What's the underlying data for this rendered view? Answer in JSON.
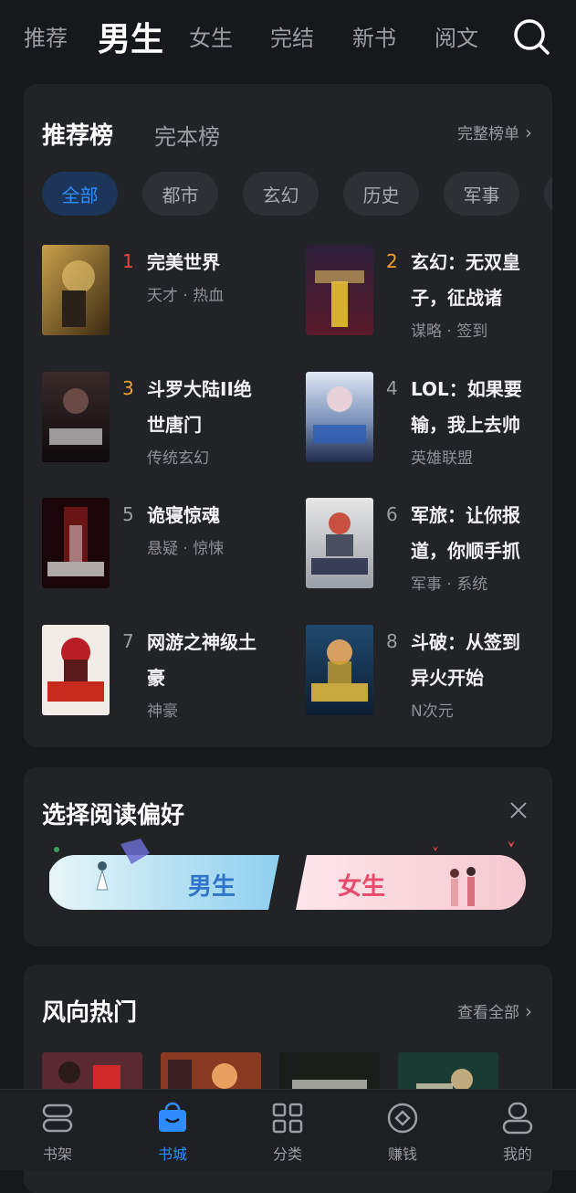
{
  "top_tabs": [
    "推荐",
    "男生",
    "女生",
    "完结",
    "新书",
    "阅文"
  ],
  "active_top_tab": "男生",
  "ranking": {
    "tabs": [
      "推荐榜",
      "完本榜"
    ],
    "full_list_label": "完整榜单",
    "chips": [
      "全部",
      "都市",
      "玄幻",
      "历史",
      "军事"
    ],
    "books": [
      {
        "rank": "1",
        "title": "完美世界",
        "tags": "天才 · 热血"
      },
      {
        "rank": "2",
        "title": "玄幻：无双皇子，征战诸",
        "tags": "谋略 · 签到"
      },
      {
        "rank": "3",
        "title": "斗罗大陆II绝世唐门",
        "tags": "传统玄幻"
      },
      {
        "rank": "4",
        "title": "LOL：如果要输，我上去帅",
        "tags": "英雄联盟"
      },
      {
        "rank": "5",
        "title": "诡寝惊魂",
        "tags": "悬疑 · 惊悚"
      },
      {
        "rank": "6",
        "title": "军旅：让你报道，你顺手抓",
        "tags": "军事 · 系统"
      },
      {
        "rank": "7",
        "title": "网游之神级土豪",
        "tags": "神豪"
      },
      {
        "rank": "8",
        "title": "斗破：从签到异火开始",
        "tags": "N次元"
      }
    ]
  },
  "preference": {
    "title": "选择阅读偏好",
    "male_label": "男生",
    "female_label": "女生"
  },
  "hot": {
    "title": "风向热门",
    "view_all_label": "查看全部"
  },
  "bottom_nav": [
    {
      "label": "书架",
      "icon": "bookshelf-icon"
    },
    {
      "label": "书城",
      "icon": "bookstore-icon"
    },
    {
      "label": "分类",
      "icon": "category-grid-icon"
    },
    {
      "label": "赚钱",
      "icon": "earn-coin-icon"
    },
    {
      "label": "我的",
      "icon": "profile-icon"
    }
  ],
  "colors": {
    "accent": "#2f8cff",
    "background": "#16181b",
    "card": "#212327",
    "rank1": "#e8453c",
    "rank2_3": "#f0a030"
  }
}
